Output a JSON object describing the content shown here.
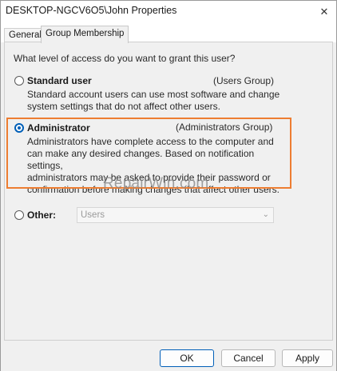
{
  "window": {
    "title": "DESKTOP-NGCV6O5\\John Properties",
    "close_glyph": "✕"
  },
  "tabs": [
    {
      "label": "General",
      "selected": false
    },
    {
      "label": "Group Membership",
      "selected": true
    }
  ],
  "question": "What level of access do you want to grant this user?",
  "options": {
    "standard": {
      "label": "Standard user",
      "group": "(Users Group)",
      "description_lines": [
        "Standard account users can use most software and change",
        "system settings that do not affect other users."
      ],
      "selected": false
    },
    "administrator": {
      "label": "Administrator",
      "group": "(Administrators Group)",
      "description_lines": [
        "Administrators have complete access to the computer and",
        "can make any desired changes. Based on notification settings,",
        "administrators may be asked to provide their password or",
        "confirmation before making changes that affect other users."
      ],
      "selected": true
    },
    "other": {
      "label": "Other:",
      "selected_value": "Users",
      "selected": false
    }
  },
  "watermark": "RepairWin.com",
  "buttons": {
    "ok": "OK",
    "cancel": "Cancel",
    "apply": "Apply"
  },
  "colors": {
    "accent": "#005fb8",
    "highlight": "#ed7d31"
  }
}
